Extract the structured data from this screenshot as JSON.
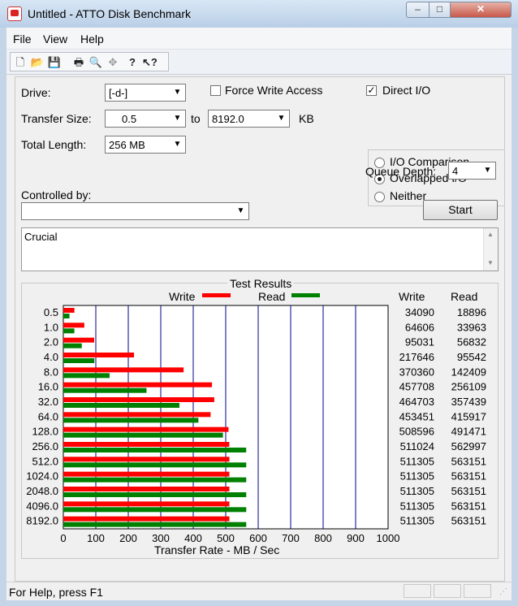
{
  "window": {
    "title": "Untitled - ATTO Disk Benchmark",
    "min": "–",
    "max": "□",
    "close": "✕"
  },
  "menu": [
    "File",
    "View",
    "Help"
  ],
  "toolbar": {
    "icons": [
      "new-icon",
      "open-icon",
      "save-icon",
      "print-icon",
      "print-preview-icon",
      "move-icon",
      "help-icon",
      "context-help-icon"
    ]
  },
  "settings": {
    "drive_label": "Drive:",
    "drive_value": "[-d-]",
    "force_write_label": "Force Write Access",
    "force_write_checked": false,
    "direct_io_label": "Direct I/O",
    "direct_io_checked": true,
    "transfer_size_label": "Transfer Size:",
    "transfer_from": "0.5",
    "to_label": "to",
    "transfer_to": "8192.0",
    "kb_label": "KB",
    "total_length_label": "Total Length:",
    "total_length_value": "256 MB",
    "io_comparison_label": "I/O Comparison",
    "overlapped_label": "Overlapped I/O",
    "neither_label": "Neither",
    "queue_depth_label": "Queue Depth:",
    "queue_depth_value": "4",
    "controlled_by_label": "Controlled by:",
    "controlled_by_value": "",
    "start_label": "Start",
    "description": "Crucial"
  },
  "results": {
    "title": "Test Results",
    "write_legend": "Write",
    "read_legend": "Read",
    "write_col": "Write",
    "read_col": "Read",
    "xlabel": "Transfer Rate - MB / Sec"
  },
  "colors": {
    "write": "#ff0000",
    "read": "#008000"
  },
  "status": {
    "text": "For Help, press F1"
  },
  "chart_data": {
    "type": "bar",
    "categories": [
      "0.5",
      "1.0",
      "2.0",
      "4.0",
      "8.0",
      "16.0",
      "32.0",
      "64.0",
      "128.0",
      "256.0",
      "512.0",
      "1024.0",
      "2048.0",
      "4096.0",
      "8192.0"
    ],
    "series": [
      {
        "name": "Write",
        "values": [
          34090,
          64606,
          95031,
          217646,
          370360,
          457708,
          464703,
          453451,
          508596,
          511024,
          511305,
          511305,
          511305,
          511305,
          511305
        ]
      },
      {
        "name": "Read",
        "values": [
          18896,
          33963,
          56832,
          95542,
          142409,
          256109,
          357439,
          415917,
          491471,
          562997,
          563151,
          563151,
          563151,
          563151,
          563151
        ]
      }
    ],
    "xticks": [
      "0",
      "100",
      "200",
      "300",
      "400",
      "500",
      "600",
      "700",
      "800",
      "900",
      "1000"
    ],
    "xlim": [
      0,
      1000
    ],
    "xlabel": "Transfer Rate - MB / Sec",
    "grid": true
  }
}
